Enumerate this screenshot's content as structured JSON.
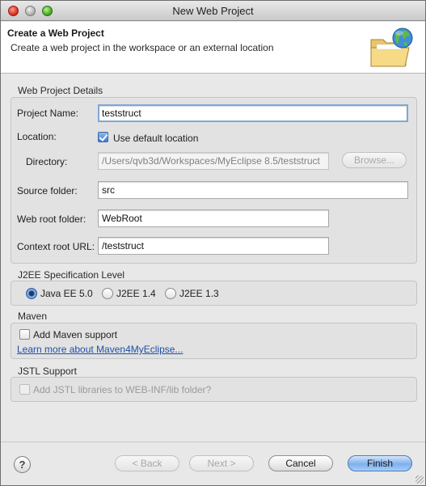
{
  "window": {
    "title": "New Web Project"
  },
  "banner": {
    "title": "Create a Web Project",
    "description": "Create a web project in the workspace or an external location",
    "icon": "globe-folder-icon"
  },
  "details": {
    "group_label": "Web Project Details",
    "project_name_label": "Project Name:",
    "project_name_value": "teststruct",
    "location_label": "Location:",
    "use_default_label": "Use default location",
    "use_default_checked": true,
    "directory_label": "Directory:",
    "directory_value": "/Users/qvb3d/Workspaces/MyEclipse 8.5/teststruct",
    "browse_label": "Browse...",
    "source_folder_label": "Source folder:",
    "source_folder_value": "src",
    "web_root_label": "Web root folder:",
    "web_root_value": "WebRoot",
    "context_root_label": "Context root URL:",
    "context_root_value": "/teststruct"
  },
  "j2ee": {
    "group_label": "J2EE Specification Level",
    "options": [
      "Java EE 5.0",
      "J2EE 1.4",
      "J2EE 1.3"
    ],
    "selected": "Java EE 5.0"
  },
  "maven": {
    "group_label": "Maven",
    "add_support_label": "Add Maven support",
    "add_support_checked": false,
    "learn_more_link": "Learn more about Maven4MyEclipse..."
  },
  "jstl": {
    "group_label": "JSTL Support",
    "add_jstl_label": "Add JSTL libraries to WEB-INF/lib folder?",
    "add_jstl_checked": false
  },
  "footer": {
    "help_label": "?",
    "back_label": "< Back",
    "next_label": "Next >",
    "cancel_label": "Cancel",
    "finish_label": "Finish"
  }
}
